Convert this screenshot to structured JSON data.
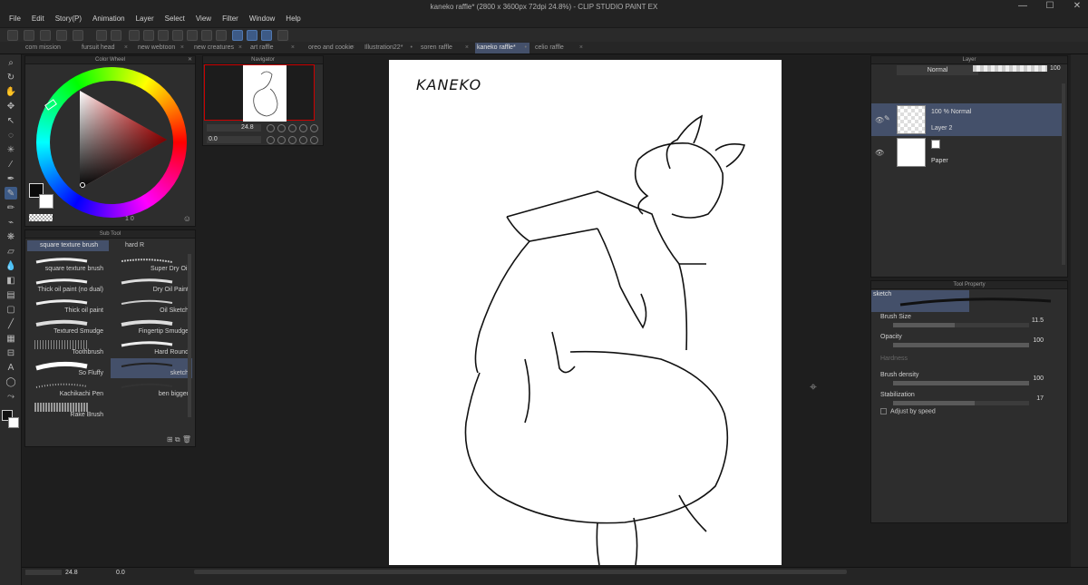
{
  "window": {
    "title": "kaneko raffle* (2800 x 3600px 72dpi 24.8%)  - CLIP STUDIO PAINT EX",
    "minimize": "—",
    "maximize": "☐",
    "close": "✕"
  },
  "menu": [
    "File",
    "Edit",
    "Story(P)",
    "Animation",
    "Layer",
    "Select",
    "View",
    "Filter",
    "Window",
    "Help"
  ],
  "tabs": [
    {
      "label": "com mission ope"
    },
    {
      "label": "fursuit head"
    },
    {
      "label": "new webtoon"
    },
    {
      "label": "new creatures"
    },
    {
      "label": "art raffle"
    },
    {
      "label": "oreo and cookie"
    },
    {
      "label": "Illustration22*"
    },
    {
      "label": "soren raffle"
    },
    {
      "label": "kaneko raffle*"
    },
    {
      "label": "celio raffle"
    }
  ],
  "panels": {
    "color_wheel": "Color Wheel",
    "navigator": "Navigator",
    "sub_tool": "Sub Tool",
    "layer": "Layer",
    "tool_property": "Tool Property"
  },
  "color_wheel": {
    "footer": "1 0"
  },
  "navigator": {
    "zoom": "24.8",
    "rotate": "0.0"
  },
  "sub_tool": {
    "selected_group": "square texture brush",
    "other_group": "hard R",
    "brushes": [
      {
        "name": "square texture brush"
      },
      {
        "name": "Super Dry Oil"
      },
      {
        "name": "Thick oil paint (no dual)"
      },
      {
        "name": "Dry Oil Paint"
      },
      {
        "name": "Thick oil paint"
      },
      {
        "name": "Oil Sketch"
      },
      {
        "name": "Textured Smudge"
      },
      {
        "name": "Fingertip Smudge"
      },
      {
        "name": "Toothbrush"
      },
      {
        "name": "Hard Round"
      },
      {
        "name": "So Fluffy"
      },
      {
        "name": "sketch"
      },
      {
        "name": "Kachikachi Pen"
      },
      {
        "name": "ben bigger"
      },
      {
        "name": "Rake Brush"
      }
    ]
  },
  "canvas": {
    "signature": "KANEKO"
  },
  "status": {
    "zoom": "24.8",
    "rotate": "0.0"
  },
  "layer": {
    "blend_mode": "Normal",
    "opacity": "100",
    "layers": [
      {
        "mode": "100 % Normal",
        "name": "Layer 2"
      },
      {
        "mode": "",
        "name": "Paper"
      }
    ]
  },
  "tool_property": {
    "tool_name": "sketch",
    "properties": [
      {
        "label": "Brush Size",
        "value": "11.5",
        "fill": 0.45
      },
      {
        "label": "Opacity",
        "value": "100",
        "fill": 1.0
      },
      {
        "label": "Hardness",
        "value": "",
        "fill": 0
      },
      {
        "label": "Brush density",
        "value": "100",
        "fill": 1.0
      },
      {
        "label": "Stabilization",
        "value": "17",
        "fill": 0.6
      }
    ],
    "adjust_by_speed": "Adjust by speed"
  }
}
